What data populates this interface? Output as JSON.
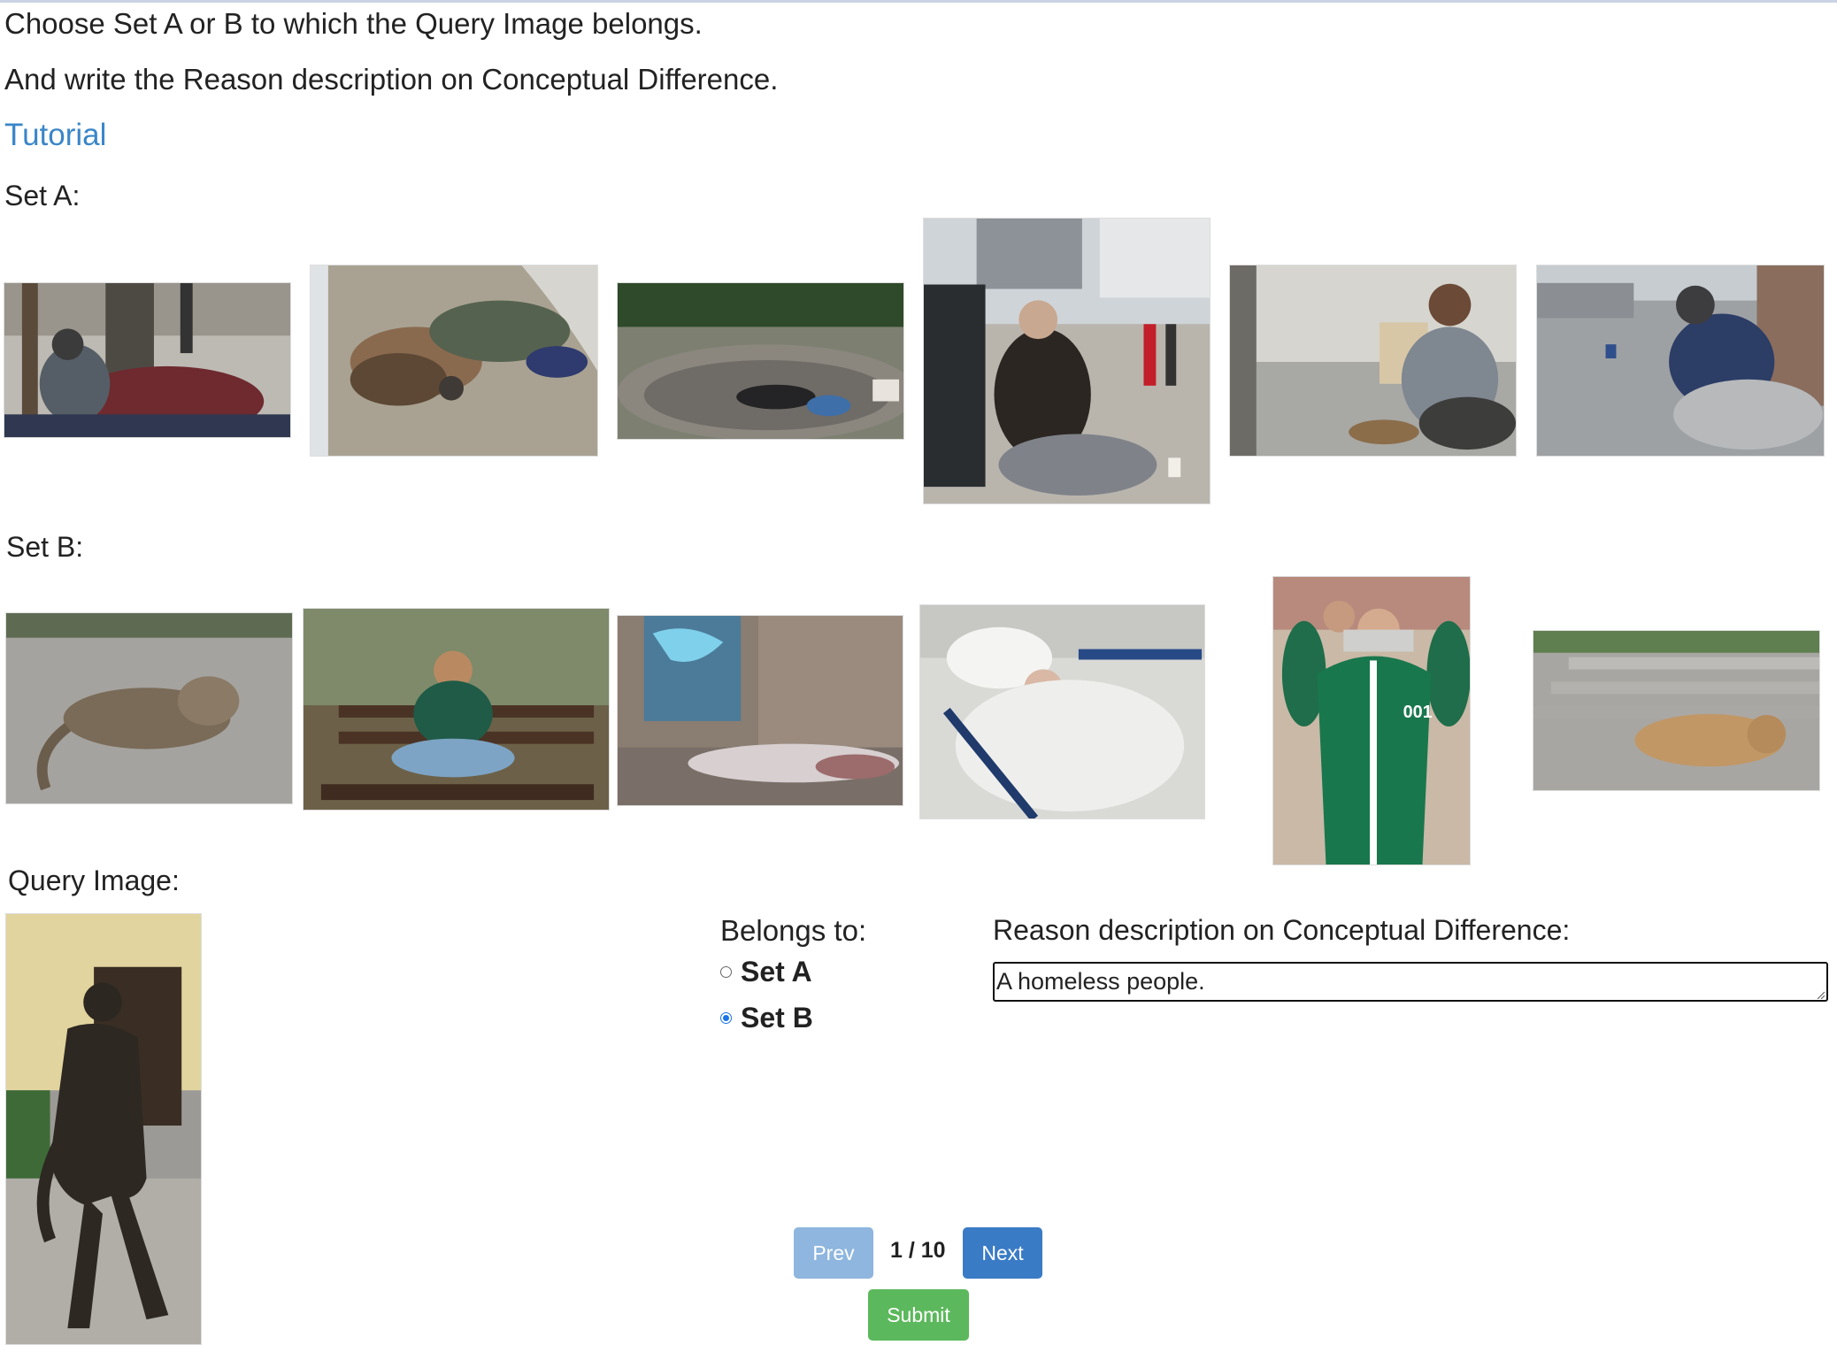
{
  "instructions": {
    "line1": "Choose Set A or B to which the Query Image belongs.",
    "line2": "And write the Reason description on Conceptual Difference.",
    "tutorial_link": "Tutorial"
  },
  "set_a": {
    "label": "Set A:",
    "images": [
      {
        "name": "homeless-person-on-sidewalk-image"
      },
      {
        "name": "person-sleeping-with-dog-image"
      },
      {
        "name": "person-sleeping-in-fountain-image"
      },
      {
        "name": "man-sitting-on-street-image"
      },
      {
        "name": "man-holding-sign-image"
      },
      {
        "name": "man-begging-with-cup-image"
      }
    ]
  },
  "set_b": {
    "label": "Set B:",
    "images": [
      {
        "name": "cat-lying-on-ground-image"
      },
      {
        "name": "girl-sitting-on-bench-image"
      },
      {
        "name": "blanket-on-street-image"
      },
      {
        "name": "elderly-man-in-hospital-bed-image"
      },
      {
        "name": "man-in-green-tracksuit-image",
        "badge": "001"
      },
      {
        "name": "dog-lying-on-steps-image"
      }
    ]
  },
  "query": {
    "label": "Query Image:",
    "image": "bronze-statue-image"
  },
  "belongs": {
    "label": "Belongs to:",
    "options": [
      {
        "label": "Set A",
        "checked": false
      },
      {
        "label": "Set B",
        "checked": true
      }
    ]
  },
  "reason": {
    "label": "Reason description on Conceptual Difference:",
    "value": "A homeless people."
  },
  "nav": {
    "prev_label": "Prev",
    "next_label": "Next",
    "page_indicator": "1 / 10",
    "submit_label": "Submit"
  },
  "colors": {
    "link": "#3a86c8",
    "prev_button": "#8eb6de",
    "next_button": "#3a7bc6",
    "submit_button": "#5cb85c",
    "radio_selected": "#1a73e8"
  }
}
